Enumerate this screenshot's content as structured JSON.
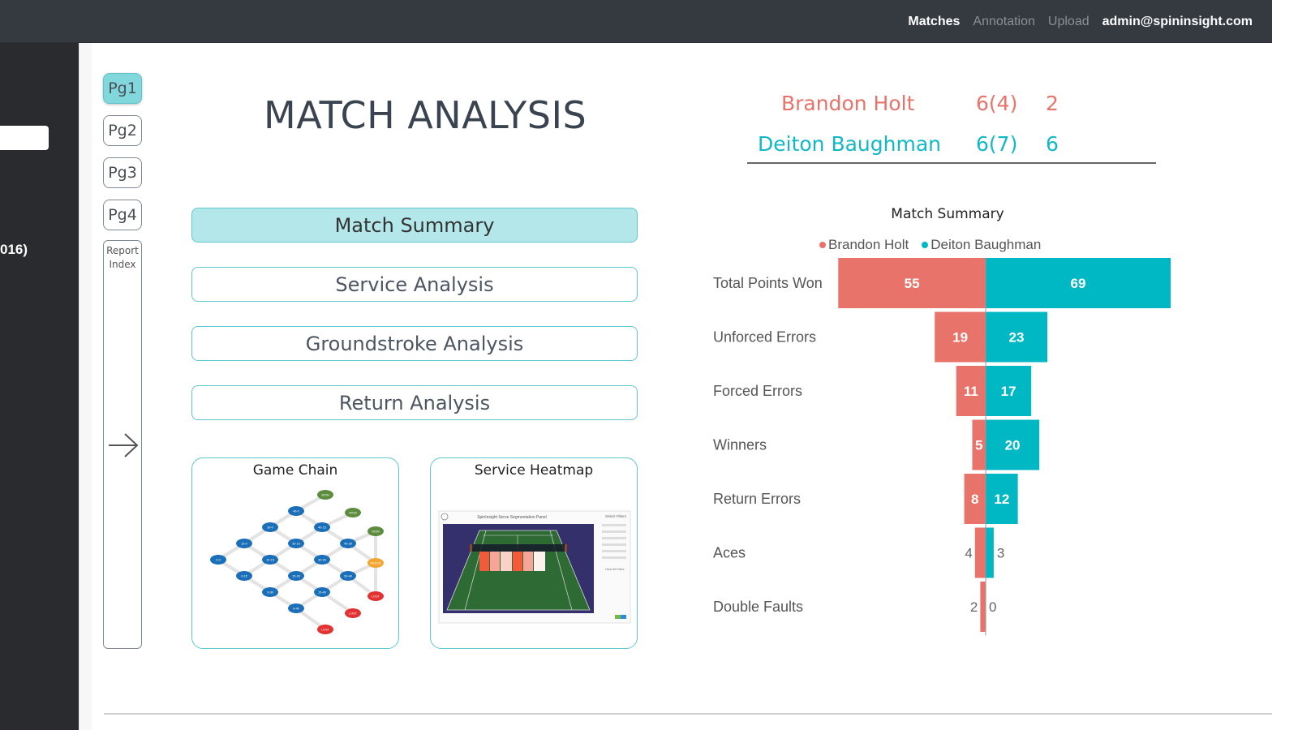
{
  "topnav": {
    "items": [
      {
        "label": "Matches",
        "state": "active"
      },
      {
        "label": "Annotation",
        "state": "muted"
      },
      {
        "label": "Upload",
        "state": "muted"
      }
    ],
    "user": "admin@spininsight.com"
  },
  "sidebar_partial_text": "016)",
  "pages": [
    {
      "label": "Pg1",
      "active": true
    },
    {
      "label": "Pg2",
      "active": false
    },
    {
      "label": "Pg3",
      "active": false
    },
    {
      "label": "Pg4",
      "active": false
    }
  ],
  "report_index": {
    "line1": "Report",
    "line2": "Index"
  },
  "title": "MATCH ANALYSIS",
  "nav_buttons": [
    {
      "label": "Match Summary",
      "active": true
    },
    {
      "label": "Service Analysis",
      "active": false
    },
    {
      "label": "Groundstroke Analysis",
      "active": false
    },
    {
      "label": "Return Analysis",
      "active": false
    }
  ],
  "cards": {
    "game_chain": {
      "title": "Game Chain",
      "nodes": [
        "0-0",
        "15-0",
        "0-15",
        "30-0",
        "15-15",
        "0-30",
        "40-0",
        "30-15",
        "15-30",
        "0-40",
        "40-15",
        "30-30",
        "15-40",
        "40-30",
        "30-40",
        "WON",
        "WON",
        "WON",
        "DEUCE",
        "LOST",
        "LOST",
        "LOST"
      ]
    },
    "service_heatmap": {
      "title": "Service Heatmap",
      "panel_title": "SpinInsight Serve Segmentation Panel",
      "filters_title": "Select Filters",
      "clear_label": "Clear All Filters"
    }
  },
  "scoreboard": {
    "players": [
      {
        "name": "Brandon Holt",
        "set1": "6(4)",
        "set2": "2",
        "color": "#e8736a"
      },
      {
        "name": "Deiton Baughman",
        "set1": "6(7)",
        "set2": "6",
        "color": "#12b8c6"
      }
    ]
  },
  "colors": {
    "player1": "#e8736a",
    "player2": "#00b8c4",
    "accent_border": "#5ec8cf",
    "active_button": "#b3e7ea",
    "active_page": "#80d8dc"
  },
  "chart_data": {
    "type": "bar",
    "orientation": "horizontal-diverging",
    "title": "Match Summary",
    "categories": [
      "Total Points Won",
      "Unforced Errors",
      "Forced Errors",
      "Winners",
      "Return Errors",
      "Aces",
      "Double Faults"
    ],
    "series": [
      {
        "name": "Brandon Holt",
        "values": [
          55,
          19,
          11,
          5,
          8,
          4,
          2
        ],
        "color": "#e8736a"
      },
      {
        "name": "Deiton Baughman",
        "values": [
          69,
          23,
          17,
          20,
          12,
          3,
          0
        ],
        "color": "#00b8c4"
      }
    ],
    "legend": "top-center",
    "xlim": [
      -69,
      69
    ],
    "grid": false
  }
}
